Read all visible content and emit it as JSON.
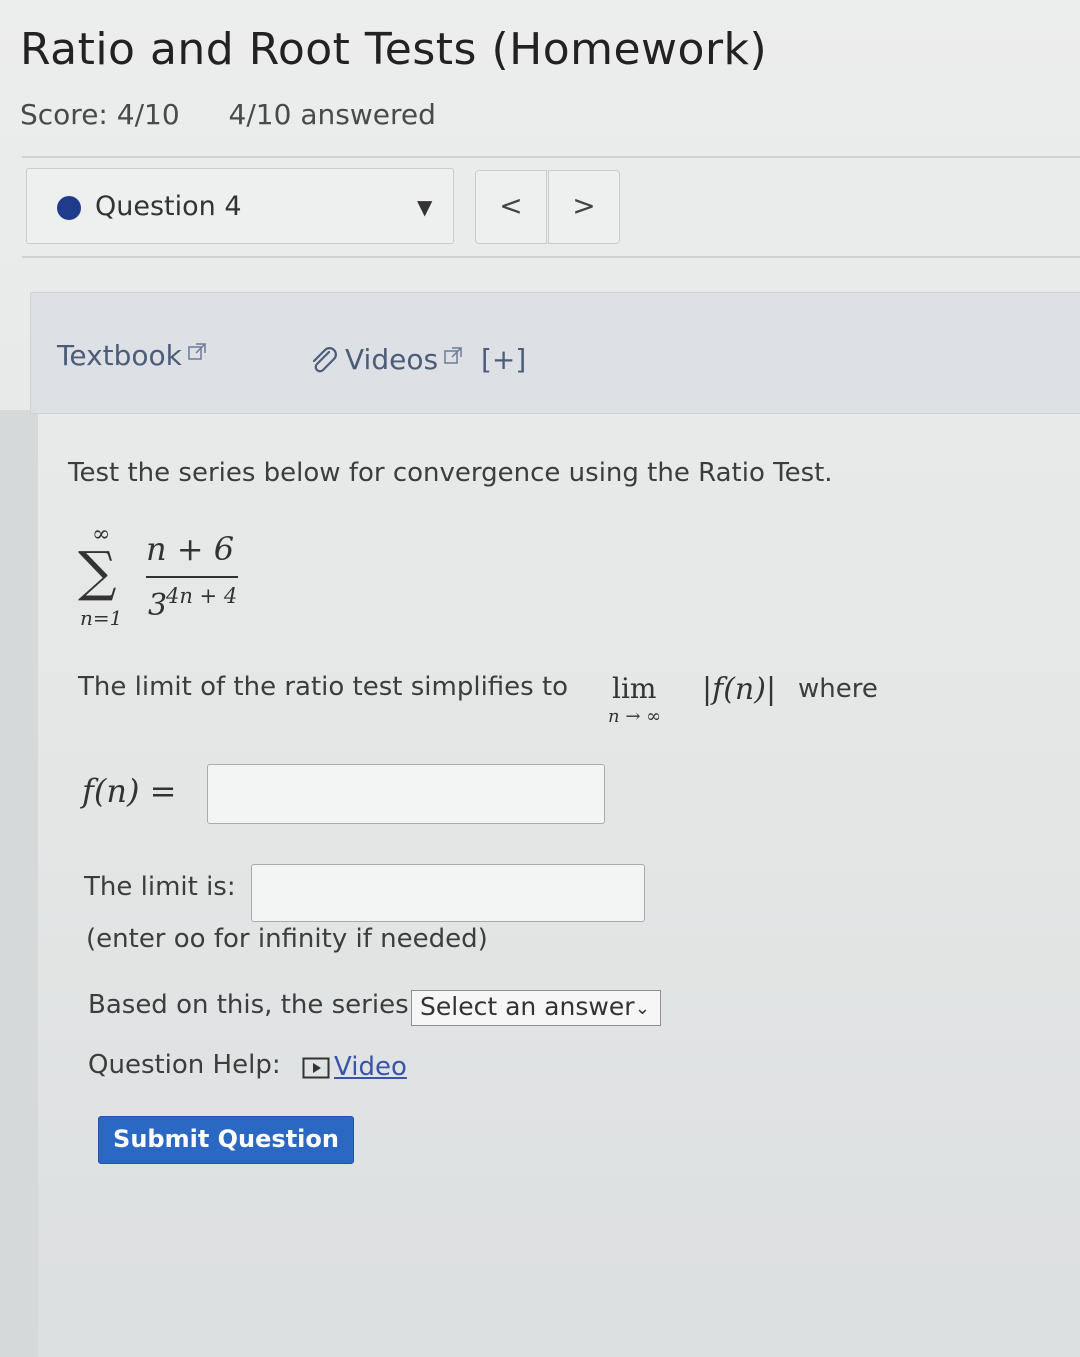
{
  "header": {
    "title": "Ratio and Root Tests (Homework)",
    "score": "Score: 4/10",
    "answered": "4/10 answered"
  },
  "question_nav": {
    "current": "Question 4",
    "prev_label": "<",
    "next_label": ">"
  },
  "resources": {
    "textbook": "Textbook",
    "videos": "Videos",
    "videos_expand": "[+]"
  },
  "problem": {
    "prompt": "Test the series below for convergence using the Ratio Test.",
    "series": {
      "upper": "∞",
      "lower": "n=1",
      "numerator": "n + 6",
      "denominator_base": "3",
      "denominator_exp": "4n + 4"
    },
    "ratio_text": "The limit of the ratio test simplifies to",
    "lim": "lim",
    "lim_sub": "n → ∞",
    "abs_expr": "|f(n)|",
    "where": "where",
    "fn_label": "f(n) =",
    "fn_value": "",
    "limit_label": "The limit is:",
    "limit_value": "",
    "limit_hint": "(enter oo for infinity if needed)",
    "series_label": "Based on this, the series",
    "series_select": "Select an answer"
  },
  "help": {
    "label": "Question Help:",
    "video": "Video"
  },
  "submit_label": "Submit Question",
  "colors": {
    "accent": "#2a68c3",
    "question_dot": "#1f3c8c",
    "link": "#4c5d7a"
  }
}
